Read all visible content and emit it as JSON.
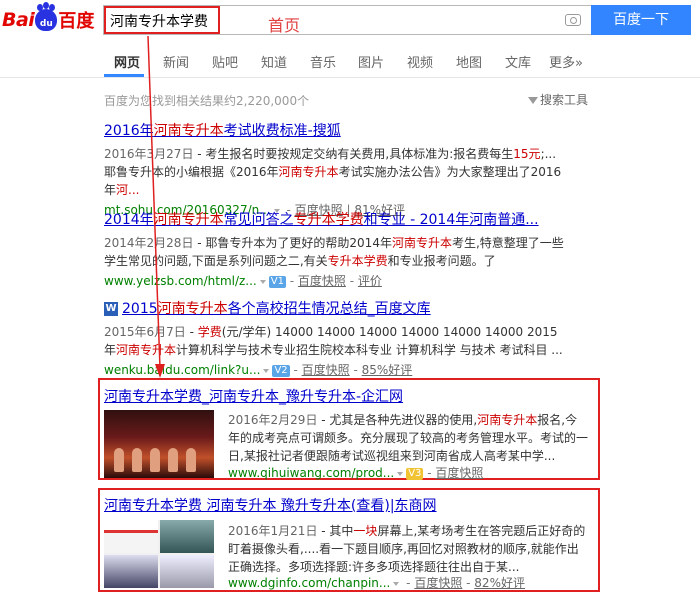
{
  "logo": {
    "bai": "Bai",
    "du": "du",
    "baidu": "百度"
  },
  "search": {
    "query": "河南专升本学费",
    "button": "百度一下"
  },
  "annotation": {
    "home": "首页"
  },
  "tabs": [
    "网页",
    "新闻",
    "贴吧",
    "知道",
    "音乐",
    "图片",
    "视频",
    "地图",
    "文库",
    "更多»"
  ],
  "result_count": "百度为您找到相关结果约2,220,000个",
  "search_tools": "搜索工具",
  "results": [
    {
      "title_a": "2016年",
      "title_hl": "河南专升本",
      "title_b": "考试收费标准-搜狐",
      "date": "2016年3月27日",
      "abs_1": " - 考生报名时要按规定交纳有关费用,具体标准为:报名费每生",
      "abs_red1": "15元",
      "abs_2": ";... 耶鲁专升本的小编根据《2016年",
      "abs_red2": "河南专升本",
      "abs_3": "考试实施办法公告》为大家整理出了2016年",
      "abs_red3": "河...",
      "url": "mt.sohu.com/20160327/n...",
      "kz": "百度快照",
      "rating": "81%好评"
    },
    {
      "title_a": "2014年",
      "title_hl": "河南专升本",
      "title_b": "常见问答之",
      "title_hl2": "专升本学费",
      "title_c": "和专业 - 2014年河南普通...",
      "date": "2014年2月28日",
      "abs_1": " - 耶鲁专升本为了更好的帮助2014年",
      "abs_red1": "河南专升本",
      "abs_2": "考生,特意整理了一些学生常见的问题,下面是系列问题之二,有关",
      "abs_red2": "专升本学费",
      "abs_3": "和专业报考问题。了",
      "url": "www.yelzsb.com/html/z...",
      "v": "V1",
      "kz": "百度快照",
      "rating": "评价"
    },
    {
      "title_a": "2015",
      "title_hl": "河南专升本",
      "title_b": "各个高校招生情况总结_百度文库",
      "w": "W",
      "date": "2015年6月7日",
      "abs_1": " - ",
      "abs_red1": "学费",
      "abs_2": "(元/学年) 14000 14000 14000 14000 14000 14000 2015 年",
      "abs_red2": "河南专升本",
      "abs_3": "计算机科学与技术专业招生院校本科专业 计算机科学 与技术 考试科目 ...",
      "url": "wenku.baidu.com/link?u...",
      "v": "V2",
      "kz": "百度快照",
      "rating": "85%好评"
    },
    {
      "title": "河南专升本学费_河南专升本_豫升专升本-企汇网",
      "date": "2016年2月29日",
      "abs_1": " - 尤其是各种先进仪器的使用,",
      "abs_red1": "河南专升本",
      "abs_2": "报名,今年的成考亮点可谓颇多。充分展现了较高的考务管理水平。考试的一日,某报社记者便跟随考试巡视组来到河南省成人高考某中学...",
      "url": "www.qihuiwang.com/prod...",
      "v": "V3",
      "kz": "百度快照"
    },
    {
      "title": "河南专升本学费 河南专升本 豫升专升本(查看)|东商网",
      "date": "2016年1月21日",
      "abs_1": " - 其中",
      "abs_red1": "一块",
      "abs_2": "屏幕上,某考场考生在答完题后正好奇的盯着摄像头看,....看一下题目顺序,再回忆对照教材的顺序,就能作出正确选择。多项选择题:许多多项选择题往往出自于某...",
      "url": "www.dginfo.com/chanpin...",
      "kz": "百度快照",
      "rating": "82%好评"
    }
  ],
  "colors": {
    "accent": "#3385ff",
    "highlight_box": "#e02020",
    "link": "#0000cc",
    "url": "#008000"
  }
}
